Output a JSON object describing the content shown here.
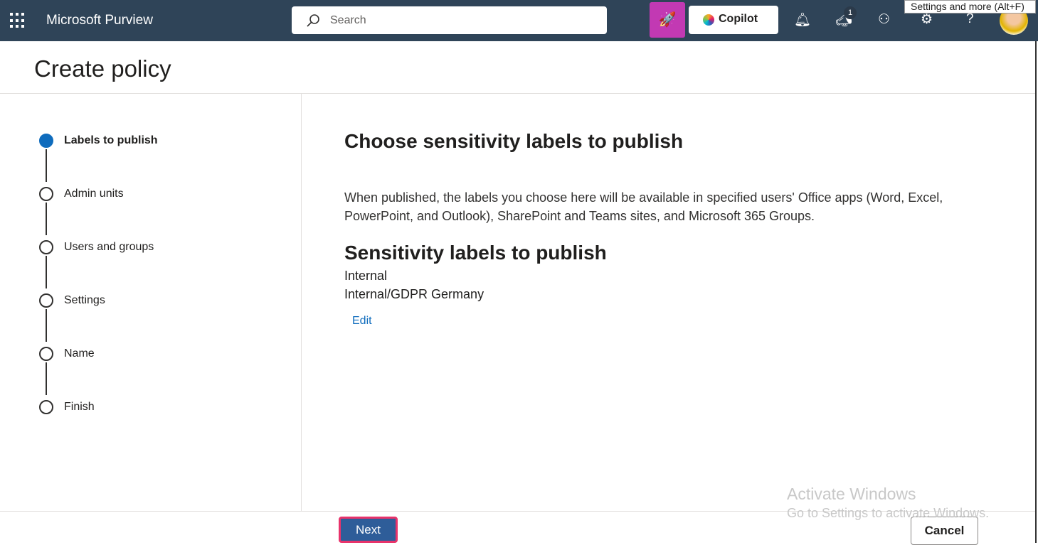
{
  "topbar": {
    "app_name": "Microsoft Purview",
    "search_placeholder": "Search",
    "copilot_label": "Copilot",
    "notification_badge": "1",
    "tooltip": "Settings and more (Alt+F)"
  },
  "page": {
    "title": "Create policy"
  },
  "steps": [
    {
      "label": "Labels to publish",
      "state": "current"
    },
    {
      "label": "Admin units",
      "state": "pending"
    },
    {
      "label": "Users and groups",
      "state": "pending"
    },
    {
      "label": "Settings",
      "state": "pending"
    },
    {
      "label": "Name",
      "state": "pending"
    },
    {
      "label": "Finish",
      "state": "pending"
    }
  ],
  "main": {
    "heading": "Choose sensitivity labels to publish",
    "description": "When published, the labels you choose here will be available in specified users' Office apps (Word, Excel, PowerPoint, and Outlook), SharePoint and Teams sites, and Microsoft 365 Groups.",
    "section_heading": "Sensitivity labels to publish",
    "labels": [
      "Internal",
      "Internal/GDPR Germany"
    ],
    "edit_label": "Edit"
  },
  "footer": {
    "next_label": "Next",
    "cancel_label": "Cancel"
  },
  "watermark": {
    "line1": "Activate Windows",
    "line2": "Go to Settings to activate Windows."
  }
}
